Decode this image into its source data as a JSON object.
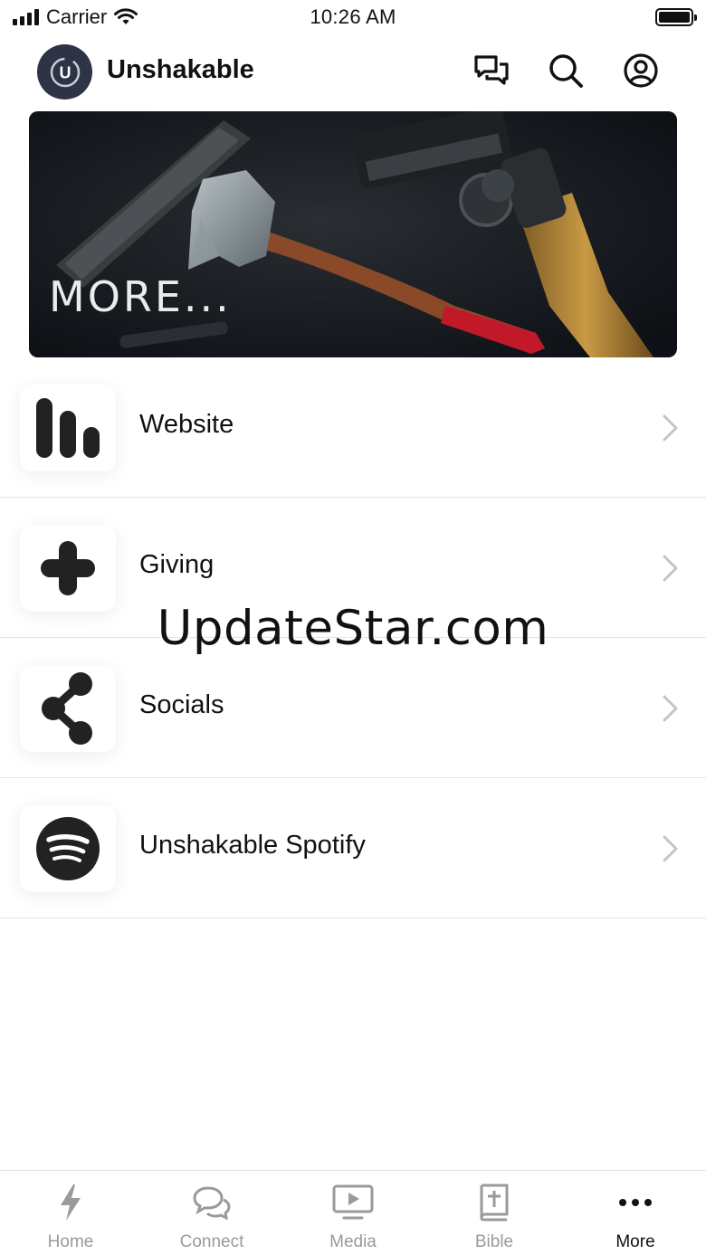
{
  "status_bar": {
    "carrier": "Carrier",
    "time": "10:26 AM"
  },
  "header": {
    "title": "Unshakable",
    "logo_letter": "U",
    "icons": [
      "chat-bubbles-icon",
      "search-icon",
      "account-icon"
    ]
  },
  "banner": {
    "text": "MORE..."
  },
  "list": {
    "items": [
      {
        "label": "Website",
        "icon": "bars-icon"
      },
      {
        "label": "Giving",
        "icon": "plus-icon"
      },
      {
        "label": "Socials",
        "icon": "share-icon"
      },
      {
        "label": "Unshakable Spotify",
        "icon": "spotify-icon"
      }
    ]
  },
  "watermark": "UpdateStar.com",
  "tabs": [
    {
      "label": "Home",
      "icon": "bolt-icon",
      "active": false
    },
    {
      "label": "Connect",
      "icon": "chat-icon",
      "active": false
    },
    {
      "label": "Media",
      "icon": "play-screen-icon",
      "active": false
    },
    {
      "label": "Bible",
      "icon": "bible-icon",
      "active": false
    },
    {
      "label": "More",
      "icon": "more-dots-icon",
      "active": true
    }
  ],
  "colors": {
    "logo_bg": "#2e3446",
    "active_tab": "#111111",
    "inactive_tab": "#9a9a9a",
    "divider": "#e4e4e4"
  }
}
